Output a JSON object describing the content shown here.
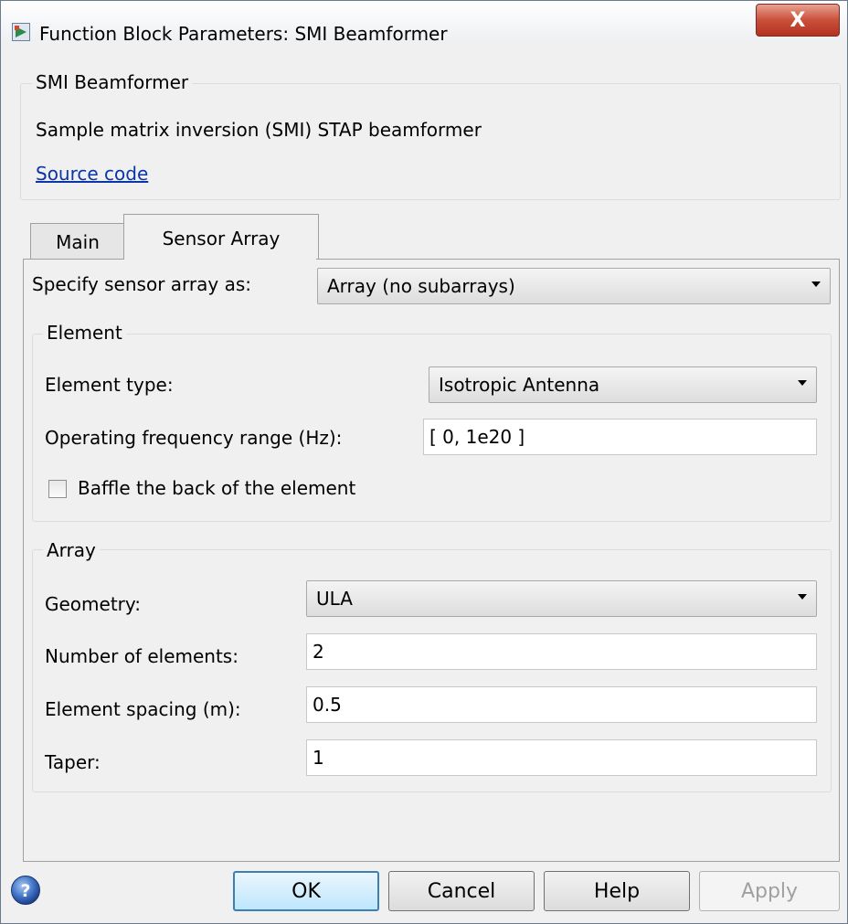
{
  "window": {
    "title": "Function Block Parameters: SMI Beamformer",
    "close_label": "X"
  },
  "description": {
    "group_title": "SMI Beamformer",
    "text": "Sample matrix inversion (SMI) STAP beamformer",
    "source_link": "Source code"
  },
  "tabs": [
    {
      "label": "Main",
      "active": false
    },
    {
      "label": "Sensor Array",
      "active": true
    }
  ],
  "sensor_array": {
    "specify_label": "Specify sensor array as:",
    "specify_value": "Array (no subarrays)"
  },
  "element": {
    "group_title": "Element",
    "type_label": "Element type:",
    "type_value": "Isotropic Antenna",
    "freq_label": "Operating frequency range (Hz):",
    "freq_value": "[ 0, 1e20 ]",
    "baffle_label": "Baffle the back of the element",
    "baffle_checked": false
  },
  "array": {
    "group_title": "Array",
    "geometry_label": "Geometry:",
    "geometry_value": "ULA",
    "num_label": "Number of elements:",
    "num_value": "2",
    "spacing_label": "Element spacing (m):",
    "spacing_value": "0.5",
    "taper_label": "Taper:",
    "taper_value": "1"
  },
  "buttons": {
    "ok": "OK",
    "cancel": "Cancel",
    "help": "Help",
    "apply": "Apply"
  },
  "icons": {
    "app": "simulink-block-icon",
    "help": "help-circle-icon"
  },
  "colors": {
    "link": "#0b35a8",
    "close": "#c9503b",
    "default_button": "#3c7fb1"
  }
}
